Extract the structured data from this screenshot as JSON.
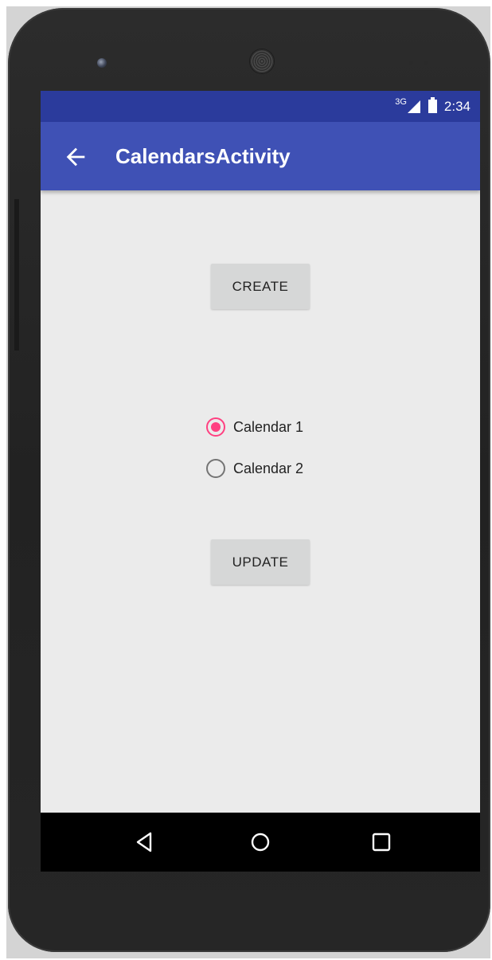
{
  "status_bar": {
    "network_type": "3G",
    "time": "2:34"
  },
  "app_bar": {
    "title": "CalendarsActivity",
    "back_icon": "arrow-back-icon"
  },
  "buttons": {
    "create_label": "CREATE",
    "update_label": "UPDATE"
  },
  "calendar_options": {
    "selected": "Calendar 1",
    "items": [
      {
        "label": "Calendar 1",
        "checked": true
      },
      {
        "label": "Calendar 2",
        "checked": false
      }
    ]
  },
  "nav_bar": {
    "icons": [
      "back-triangle-icon",
      "home-circle-icon",
      "recents-square-icon"
    ]
  },
  "colors": {
    "status_bar": "#2b3b9c",
    "app_bar": "#3f51b5",
    "accent": "#ff4081",
    "screen_background": "#ebebeb",
    "button_background": "#d6d7d7"
  }
}
